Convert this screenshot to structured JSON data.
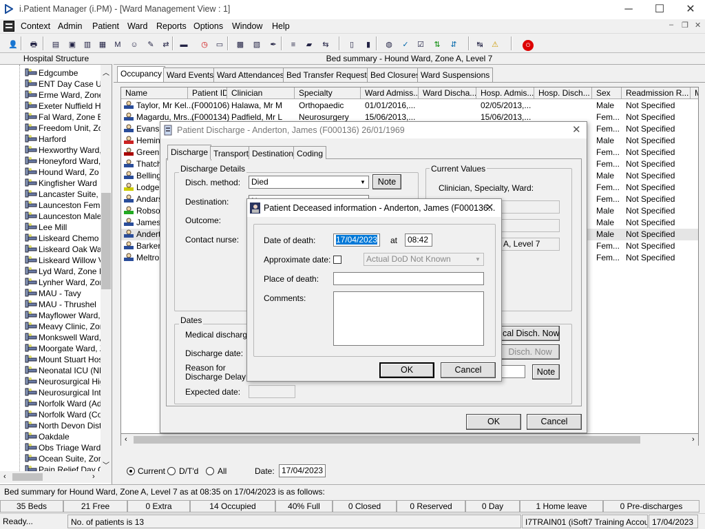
{
  "window": {
    "title": "i.Patient Manager (i.PM) - [Ward Management View : 1]",
    "app_icon": "play-triangle-icon"
  },
  "menus": [
    "Context",
    "Admin",
    "Patient",
    "Ward",
    "Reports",
    "Options",
    "Window",
    "Help"
  ],
  "toolbar_icons": [
    "patient-icon",
    "printer-icon",
    "books-icon",
    "book-red-icon",
    "document-icon",
    "doc-blue-icon",
    "m-icon",
    "person-card-icon",
    "notes-icon",
    "transfer-icon",
    "bed-icon",
    "scissors-icon",
    "clock-icon",
    "monitor-icon",
    "image-icon",
    "chart-icon",
    "pen-icon",
    "list-icon",
    "car-icon",
    "bed-move-icon",
    "page-icon",
    "bar-chart-icon",
    "globe-icon",
    "check-icon",
    "check-list-icon",
    "green-arrows-icon",
    "blue-arrows-icon",
    "swap-icon",
    "warning-icon",
    "exit-icon"
  ],
  "left_panel": {
    "header": "Hospital Structure",
    "items": [
      "Edgcumbe",
      "ENT Day Case U",
      "Erme Ward, Zone",
      "Exeter Nuffield H",
      "Fal Ward, Zone E",
      "Freedom Unit, Zo",
      "Harford",
      "Hexworthy Ward,",
      "Honeyford Ward,",
      "Hound Ward, Zo",
      "Kingfisher Ward",
      "Lancaster Suite, Z",
      "Launceston Fema",
      "Launceston Male",
      "Lee Mill",
      "Liskeard Chemo D",
      "Liskeard Oak Wa",
      "Liskeard Willow V",
      "Lyd Ward, Zone I",
      "Lynher Ward, Zor",
      "MAU - Tavy",
      "MAU - Thrushel",
      "Mayflower Ward,",
      "Meavy Clinic, Zor",
      "Monkswell Ward,",
      "Moorgate Ward, Z",
      "Mount Stuart Hos",
      "Neonatal ICU (NN",
      "Neurosurgical Hig",
      "Neurosurgical Inte",
      "Norfolk Ward (Ad",
      "Norfolk Ward (Co",
      "North Devon Dist",
      "Oakdale",
      "Obs Triage Ward",
      "Ocean Suite, Zor",
      "Pain Relief Day C"
    ]
  },
  "main": {
    "title": "Bed summary - Hound Ward, Zone A, Level 7",
    "tabs": [
      "Occupancy",
      "Ward Events",
      "Ward Attendances",
      "Bed Transfer Requests",
      "Bed Closures",
      "Ward Suspensions"
    ],
    "columns": [
      "Name",
      "Patient ID",
      "Clinician",
      "Specialty",
      "Ward Admiss...",
      "Ward Discha...",
      "Hosp. Admis...",
      "Hosp. Disch...",
      "Sex",
      "Readmission R...",
      "Me"
    ],
    "rows": [
      {
        "name": "Taylor, Mr Kel...",
        "id": "(F000106)",
        "clinician": "Halawa, Mr M",
        "specialty": "Orthopaedic",
        "ward_adm": "01/01/2016,...",
        "ward_dis": "",
        "hosp_adm": "02/05/2013,...",
        "hosp_dis": "",
        "sex": "Male",
        "readm": "Not Specified",
        "icon": "patient-bed-icon"
      },
      {
        "name": "Magardu, Mrs...",
        "id": "(F000134)",
        "clinician": "Padfield, Mr L",
        "specialty": "Neurosurgery",
        "ward_adm": "15/06/2013,...",
        "ward_dis": "",
        "hosp_adm": "15/06/2013,...",
        "hosp_dis": "",
        "sex": "Fem...",
        "readm": "Not Specified",
        "icon": "patient-bed-icon"
      },
      {
        "name": "Evans,",
        "id": "",
        "clinician": "",
        "specialty": "",
        "ward_adm": "",
        "ward_dis": "",
        "hosp_adm": "",
        "hosp_dis": "",
        "sex": "Fem...",
        "readm": "Not Specified",
        "icon": "patient-bed-icon"
      },
      {
        "name": "Heming",
        "id": "",
        "clinician": "",
        "specialty": "",
        "ward_adm": "",
        "ward_dis": "",
        "hosp_adm": "",
        "hosp_dis": "",
        "sex": "Male",
        "readm": "Not Specified",
        "icon": "patient-alert-red-icon"
      },
      {
        "name": "Green,",
        "id": "",
        "clinician": "",
        "specialty": "",
        "ward_adm": "",
        "ward_dis": "",
        "hosp_adm": "",
        "hosp_dis": "",
        "sex": "Fem...",
        "readm": "Not Specified",
        "icon": "patient-red-face-icon"
      },
      {
        "name": "Thatch",
        "id": "",
        "clinician": "",
        "specialty": "",
        "ward_adm": "",
        "ward_dis": "",
        "hosp_adm": "",
        "hosp_dis": "",
        "sex": "Fem...",
        "readm": "Not Specified",
        "icon": "patient-bed-icon"
      },
      {
        "name": "Bellingh",
        "id": "",
        "clinician": "",
        "specialty": "",
        "ward_adm": "",
        "ward_dis": "",
        "hosp_adm": "",
        "hosp_dis": "",
        "sex": "Male",
        "readm": "Not Specified",
        "icon": "patient-bed-icon"
      },
      {
        "name": "Lodger,",
        "id": "",
        "clinician": "",
        "specialty": "",
        "ward_adm": "",
        "ward_dis": "",
        "hosp_adm": "",
        "hosp_dis": "",
        "sex": "Fem...",
        "readm": "Not Specified",
        "icon": "patient-alert-yellow-icon"
      },
      {
        "name": "Andars,",
        "id": "",
        "clinician": "",
        "specialty": "",
        "ward_adm": "",
        "ward_dis": "",
        "hosp_adm": "",
        "hosp_dis": "",
        "sex": "Fem...",
        "readm": "Not Specified",
        "icon": "patient-bed-icon"
      },
      {
        "name": "Robson",
        "id": "",
        "clinician": "",
        "specialty": "",
        "ward_adm": "",
        "ward_dis": "",
        "hosp_adm": "",
        "hosp_dis": "",
        "sex": "Male",
        "readm": "Not Specified",
        "icon": "patient-alert-green-icon"
      },
      {
        "name": "James,",
        "id": "",
        "clinician": "",
        "specialty": "",
        "ward_adm": "",
        "ward_dis": "",
        "hosp_adm": "",
        "hosp_dis": "",
        "sex": "Male",
        "readm": "Not Specified",
        "icon": "patient-bed-icon"
      },
      {
        "name": "Anderto",
        "id": "",
        "clinician": "",
        "specialty": "",
        "ward_adm": "",
        "ward_dis": "",
        "hosp_adm": "",
        "hosp_dis": "",
        "sex": "Male",
        "readm": "Not Specified",
        "icon": "patient-bed-icon"
      },
      {
        "name": "Barker,",
        "id": "",
        "clinician": "",
        "specialty": "",
        "ward_adm": "",
        "ward_dis": "",
        "hosp_adm": "",
        "hosp_dis": "",
        "sex": "Fem...",
        "readm": "Not Specified",
        "icon": "patient-bed-icon"
      },
      {
        "name": "Meltron",
        "id": "",
        "clinician": "",
        "specialty": "",
        "ward_adm": "",
        "ward_dis": "",
        "hosp_adm": "",
        "hosp_dis": "",
        "sex": "Fem...",
        "readm": "Not Specified",
        "icon": "patient-bed-icon"
      }
    ],
    "radio_current": "Current",
    "radio_dtd": "D/T'd",
    "radio_all": "All",
    "date_label": "Date:",
    "date_value": "17/04/2023"
  },
  "discharge_dialog": {
    "title": "Patient Discharge - Anderton, James (F000136) 26/01/1969",
    "tabs": [
      "Discharge",
      "Transport",
      "Destination",
      "Coding"
    ],
    "details_group": "Discharge Details",
    "method_label": "Disch. method:",
    "method_value": "Died",
    "note_btn": "Note",
    "destination_label": "Destination:",
    "destination_partial": "N",
    "outcome_label": "Outcome:",
    "contact_label": "Contact nurse:",
    "current_group": "Current Values",
    "current_label": "Clinician, Specialty, Ward:",
    "current_ward_partial": "A, Level 7",
    "dates_group": "Dates",
    "medical_label": "Medical discharge:",
    "medical_now_btn": "cal Disch. Now",
    "discharge_date_label": "Discharge date:",
    "disch_now_btn": "Disch. Now",
    "reason_label_1": "Reason for",
    "reason_label_2": "Discharge Delay:",
    "reason_note_btn": "Note",
    "expected_label": "Expected date:",
    "ok": "OK",
    "cancel": "Cancel"
  },
  "deceased_dialog": {
    "title": "Patient Deceased information - Anderton, James (F000136...",
    "dod_label": "Date of death:",
    "dod_value": "17/04/2023",
    "at_label": "at",
    "time_value": "08:42",
    "approx_label": "Approximate date:",
    "approx_select": "Actual DoD Not Known",
    "place_label": "Place of death:",
    "place_value": "",
    "comments_label": "Comments:",
    "comments_value": "",
    "ok": "OK",
    "cancel": "Cancel"
  },
  "status": {
    "summary": "Bed summary for Hound Ward, Zone A, Level 7 as at 08:35 on 17/04/2023 is as follows:",
    "stats": [
      "35 Beds",
      "21 Free",
      "0 Extra",
      "14 Occupied",
      "40% Full",
      "0 Closed",
      "0 Reserved",
      "0 Day",
      "1 Home leave",
      "0 Pre-discharges"
    ],
    "ready": "Ready...",
    "patients": "No. of patients is 13",
    "user": "I7TRAIN01 (iSoft7 Training Account)",
    "date": "17/04/2023"
  }
}
